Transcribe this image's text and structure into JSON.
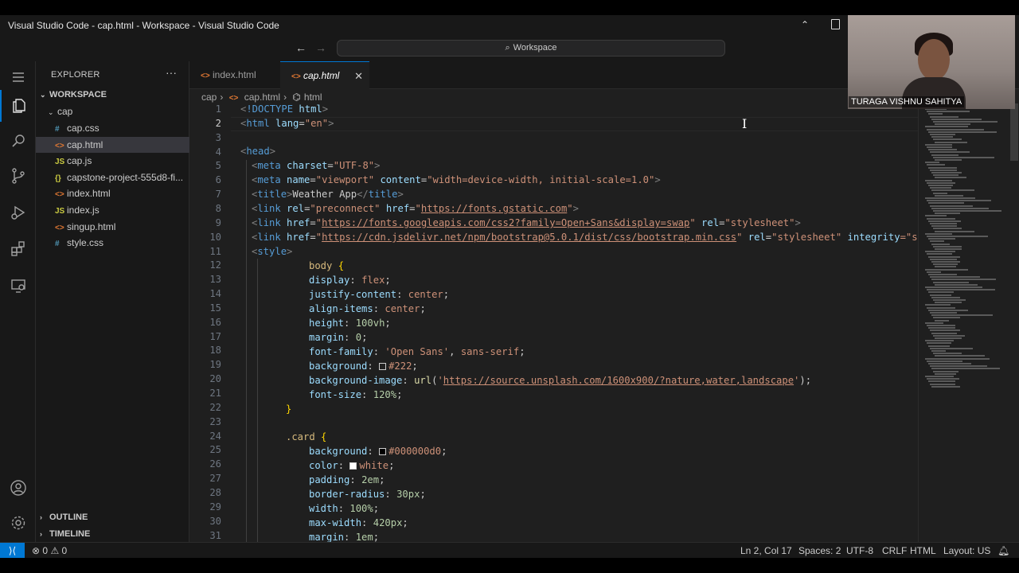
{
  "window": {
    "title": "Visual Studio Code - cap.html - Workspace - Visual Studio Code"
  },
  "titlebar": {
    "back_icon": "arrow-left-icon",
    "forward_icon": "arrow-right-icon",
    "search_label": "Workspace"
  },
  "activitybar": {
    "items": [
      "menu-icon",
      "files-icon",
      "search-icon",
      "source-control-icon",
      "run-debug-icon",
      "extensions-icon",
      "remote-explorer-icon",
      "account-icon",
      "settings-gear-icon"
    ]
  },
  "sidebar": {
    "title": "EXPLORER",
    "more": "···",
    "workspace": "WORKSPACE",
    "folder": "cap",
    "files": [
      {
        "name": "cap.css",
        "icon": "#",
        "type": "css"
      },
      {
        "name": "cap.html",
        "icon": "<>",
        "type": "html",
        "selected": true
      },
      {
        "name": "cap.js",
        "icon": "JS",
        "type": "js"
      },
      {
        "name": "capstone-project-555d8-fi...",
        "icon": "{}",
        "type": "json"
      },
      {
        "name": "index.html",
        "icon": "<>",
        "type": "html"
      },
      {
        "name": "index.js",
        "icon": "JS",
        "type": "js"
      },
      {
        "name": "singup.html",
        "icon": "<>",
        "type": "html"
      },
      {
        "name": "style.css",
        "icon": "#",
        "type": "css"
      }
    ],
    "outline": "OUTLINE",
    "timeline": "TIMELINE"
  },
  "tabs": [
    {
      "label": "index.html",
      "icon": "<>",
      "active": false
    },
    {
      "label": "cap.html",
      "icon": "<>",
      "active": true,
      "close": "✕"
    }
  ],
  "breadcrumb": [
    "cap",
    "cap.html",
    "html"
  ],
  "editor": {
    "current_line": 2,
    "line_numbers": [
      "1",
      "2",
      "3",
      "4",
      "5",
      "6",
      "7",
      "8",
      "9",
      "10",
      "11",
      "12",
      "13",
      "14",
      "15",
      "16",
      "17",
      "18",
      "19",
      "20",
      "21",
      "22",
      "23",
      "24",
      "25",
      "26",
      "27",
      "28",
      "29",
      "30",
      "31"
    ],
    "code": {
      "l1_doctype": "!DOCTYPE",
      "l1_html": "html",
      "l2_html": "html",
      "l2_attr": "lang",
      "l2_val": "\"en\"",
      "l4_head": "head",
      "l5_meta": "meta",
      "l5_attr": "charset",
      "l5_val": "\"UTF-8\"",
      "l6_meta": "meta",
      "l6_attr1": "name",
      "l6_val1": "\"viewport\"",
      "l6_attr2": "content",
      "l6_val2": "\"width=device-width, initial-scale=1.0\"",
      "l7_title": "title",
      "l7_text": "Weather App",
      "l7_close": "title",
      "l8_link": "link",
      "l8_attr1": "rel",
      "l8_val1": "\"preconnect\"",
      "l8_attr2": "href",
      "l8_url": "https://fonts.gstatic.com",
      "l9_link": "link",
      "l9_attr1": "href",
      "l9_url": "https://fonts.googleapis.com/css2?family=Open+Sans&display=swap",
      "l9_attr2": "rel",
      "l9_val2": "\"stylesheet\"",
      "l10_link": "link",
      "l10_attr1": "href",
      "l10_url": "https://cdn.jsdelivr.net/npm/bootstrap@5.0.1/dist/css/bootstrap.min.css",
      "l10_attr2": "rel",
      "l10_val2": "\"stylesheet\"",
      "l10_attr3": "integrity",
      "l10_val3": "=\"sha",
      "l11_style": "style",
      "l12_sel": "body",
      "l13_p": "display",
      "l13_v": "flex",
      "l14_p": "justify-content",
      "l14_v": "center",
      "l15_p": "align-items",
      "l15_v": "center",
      "l16_p": "height",
      "l16_v": "100vh",
      "l17_p": "margin",
      "l17_v": "0",
      "l18_p": "font-family",
      "l18_v1": "'Open Sans'",
      "l18_v2": "sans-serif",
      "l19_p": "background",
      "l19_v": "#222",
      "l20_p": "background-image",
      "l20_f": "url",
      "l20_url": "https://source.unsplash.com/1600x900/?nature,water,landscape",
      "l21_p": "font-size",
      "l21_v": "120%",
      "l24_sel": ".card",
      "l25_p": "background",
      "l25_v": "#000000d0",
      "l26_p": "color",
      "l26_v": "white",
      "l27_p": "padding",
      "l27_v": "2em",
      "l28_p": "border-radius",
      "l28_v": "30px",
      "l29_p": "width",
      "l29_v": "100%",
      "l30_p": "max-width",
      "l30_v": "420px",
      "l31_p": "margin",
      "l31_v": "1em"
    }
  },
  "webcam": {
    "name": "TURAGA VISHNU SAHITYA"
  },
  "statusbar": {
    "remote_icon": "remote-icon",
    "errors": "0",
    "warnings": "0",
    "position": "Ln 2, Col 17",
    "spaces": "Spaces: 2",
    "encoding": "UTF-8",
    "eol": "CRLF",
    "language": "HTML",
    "layout": "Layout: US",
    "notifications_icon": "bell-icon"
  },
  "colors": {
    "accent": "#0078d4",
    "editor_bg": "#1f1f1f",
    "tag": "#569cd6",
    "attribute": "#9cdcfe",
    "string": "#ce9178",
    "selector": "#d7ba7d",
    "number": "#b5cea8"
  }
}
